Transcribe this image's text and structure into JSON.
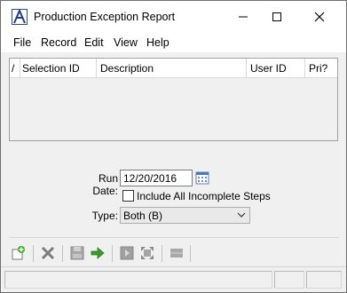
{
  "window": {
    "title": "Production Exception Report",
    "icon": "abacus-logo-icon"
  },
  "menu": {
    "items": [
      "File",
      "Record",
      "Edit",
      "View",
      "Help"
    ]
  },
  "grid": {
    "columns": [
      {
        "label": "/"
      },
      {
        "label": "Selection ID"
      },
      {
        "label": "Description"
      },
      {
        "label": "User ID"
      },
      {
        "label": "Pri?"
      }
    ],
    "rows": []
  },
  "form": {
    "run_date_label": "Run Date:",
    "run_date_value": "12/20/2016",
    "include_label": "Include All Incomplete Steps",
    "include_checked": false,
    "type_label": "Type:",
    "type_value": "Both (B)"
  },
  "toolbar": {
    "buttons": [
      "new-icon",
      "delete-icon",
      "save-icon",
      "go-arrow-icon",
      "run-icon",
      "expand-icon",
      "list-icon"
    ]
  },
  "colors": {
    "accent": "#2a4e8c",
    "go_green": "#3a9a2a",
    "new_green": "#3fae2a"
  }
}
